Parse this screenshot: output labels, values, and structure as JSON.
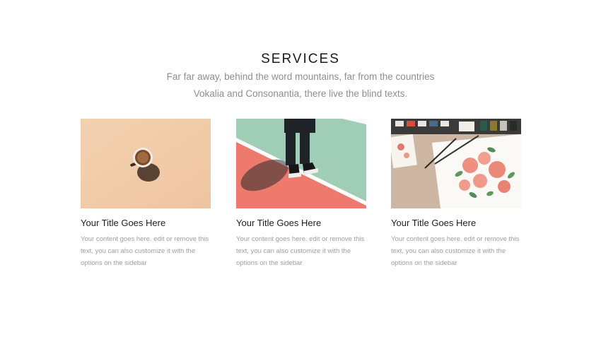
{
  "section": {
    "title": "SERVICES",
    "subtitle_line1": "Far far away, behind the word mountains, far from the countries",
    "subtitle_line2": "Vokalia and Consonantia, there live the blind texts."
  },
  "cards": [
    {
      "image_icon": "coffee-cup-photo",
      "title": "Your Title Goes Here",
      "text": "Your content goes here. edit or remove this text, you can also customize it with the options on the sidebar"
    },
    {
      "image_icon": "sneakers-court-photo",
      "title": "Your Title Goes Here",
      "text": "Your content goes here. edit or remove this text, you can also customize it with the options on the sidebar"
    },
    {
      "image_icon": "watercolor-flowers-photo",
      "title": "Your Title Goes Here",
      "text": "Your content goes here. edit or remove this text, you can also customize it with the options on the sidebar"
    }
  ],
  "colors": {
    "title": "#1a1a1a",
    "subtitle": "#8a8f96",
    "body_text": "#9aa0a6"
  }
}
